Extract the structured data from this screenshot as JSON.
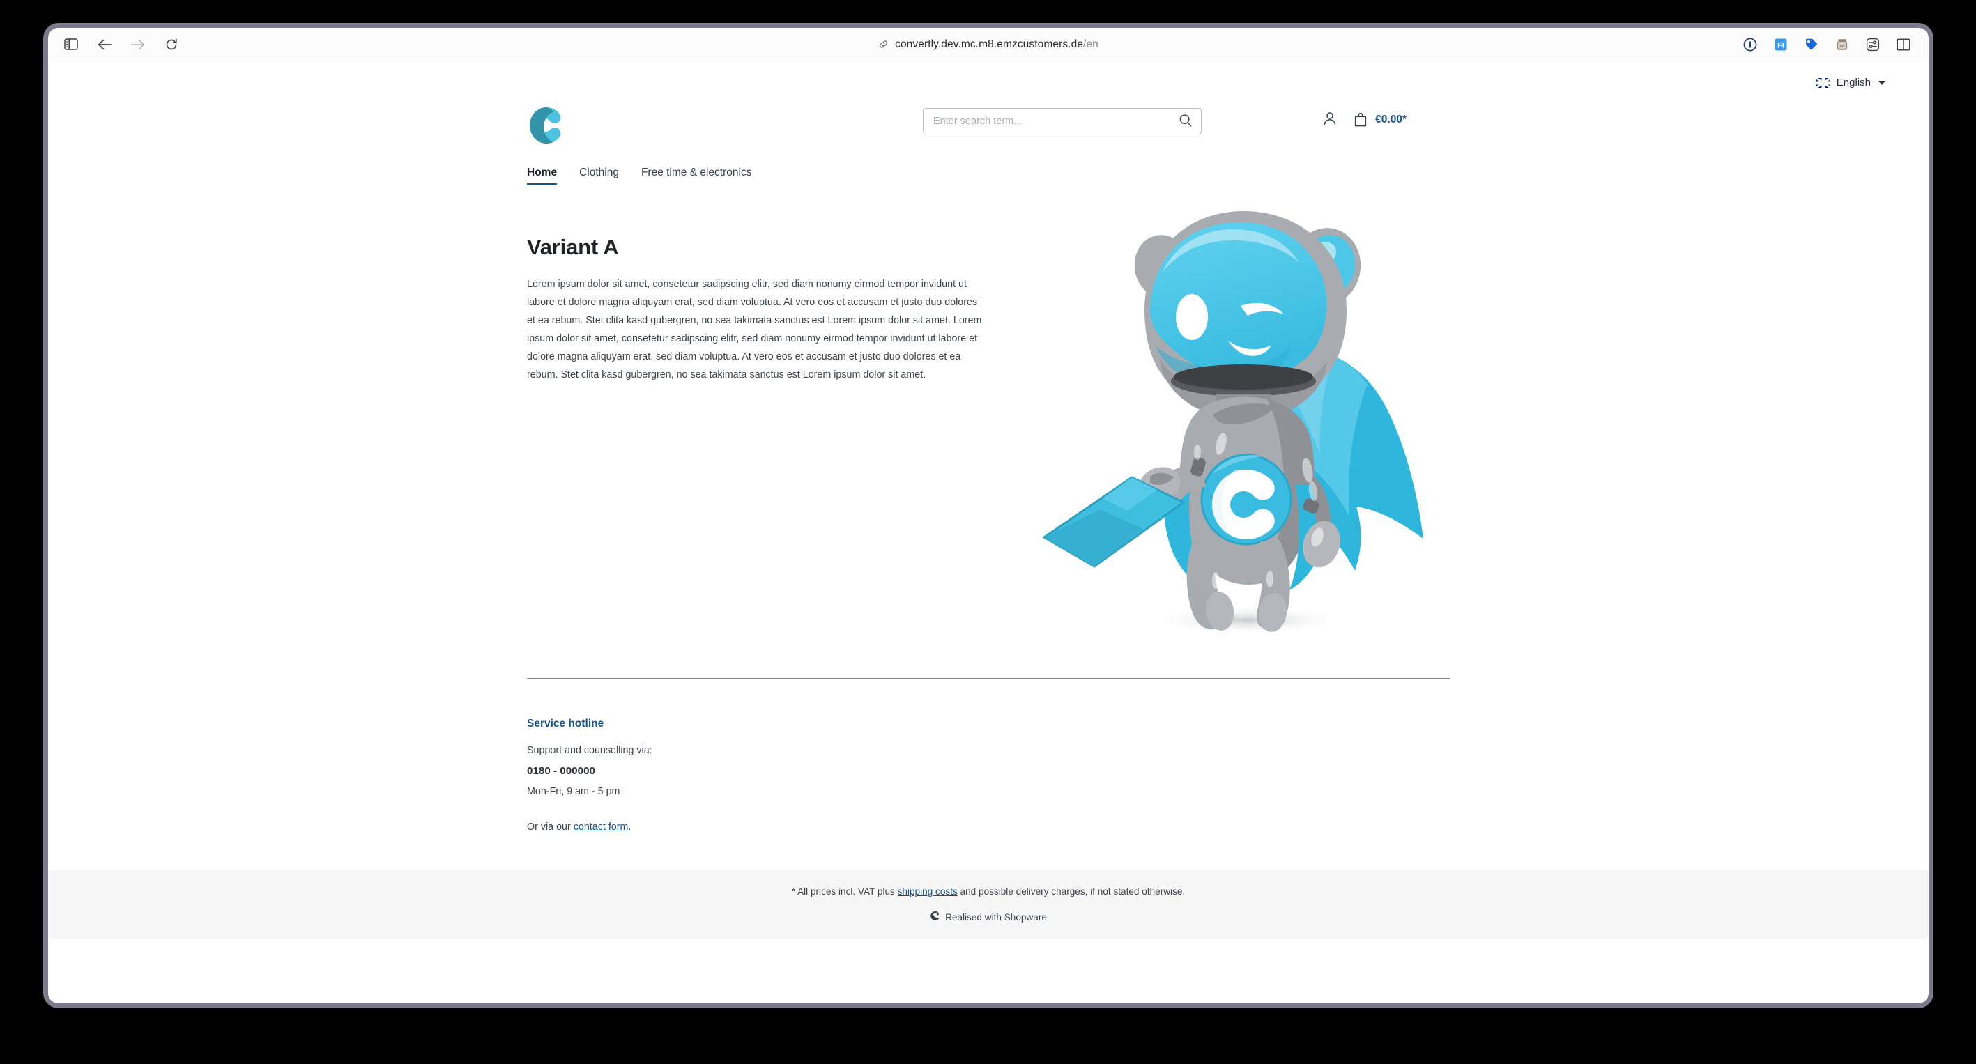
{
  "browser": {
    "url_host": "convertly.dev.mc.m8.emzcustomers.de",
    "url_path": "/en",
    "sidebar_toggle": "sidebar-toggle",
    "back": "back",
    "forward": "forward",
    "reload": "reload",
    "extensions": [
      "info-icon",
      "fi-extension-icon",
      "tag-icon",
      "jar-icon",
      "settings-sliders-icon",
      "split-view-icon"
    ]
  },
  "topbar": {
    "language_label": "English"
  },
  "header": {
    "logo_alt": "Convertly logo",
    "search_placeholder": "Enter search term...",
    "search_value": "",
    "cart_amount": "€0.00*"
  },
  "nav": {
    "items": [
      {
        "label": "Home",
        "active": true
      },
      {
        "label": "Clothing",
        "active": false
      },
      {
        "label": "Free time & electronics",
        "active": false
      }
    ]
  },
  "hero": {
    "title": "Variant A",
    "body": "Lorem ipsum dolor sit amet, consetetur sadipscing elitr, sed diam nonumy eirmod tempor invidunt ut labore et dolore magna aliquyam erat, sed diam voluptua. At vero eos et accusam et justo duo dolores et ea rebum. Stet clita kasd gubergren, no sea takimata sanctus est Lorem ipsum dolor sit amet. Lorem ipsum dolor sit amet, consetetur sadipscing elitr, sed diam nonumy eirmod tempor invidunt ut labore et dolore magna aliquyam erat, sed diam voluptua. At vero eos et accusam et justo duo dolores et ea rebum. Stet clita kasd gubergren, no sea takimata sanctus est Lorem ipsum dolor sit amet.",
    "image_alt": "robot mascot with cape holding envelope"
  },
  "footer": {
    "heading": "Service hotline",
    "support_line": "Support and counselling via:",
    "phone": "0180 - 000000",
    "hours": "Mon-Fri, 9 am - 5 pm",
    "contact_prefix": "Or via our ",
    "contact_link": "contact form",
    "contact_suffix": "."
  },
  "bottom": {
    "vat_prefix": "* All prices incl. VAT plus ",
    "vat_link": "shipping costs",
    "vat_suffix": " and possible delivery charges, if not stated otherwise.",
    "credit": "Realised with Shopware"
  },
  "colors": {
    "brand_blue": "#16538a",
    "logo_cyan_light": "#4ec3e0",
    "logo_cyan_dark": "#3293ab",
    "mascot_cyan": "#5 acded",
    "bottom_bar_bg": "#f7f7f8"
  }
}
